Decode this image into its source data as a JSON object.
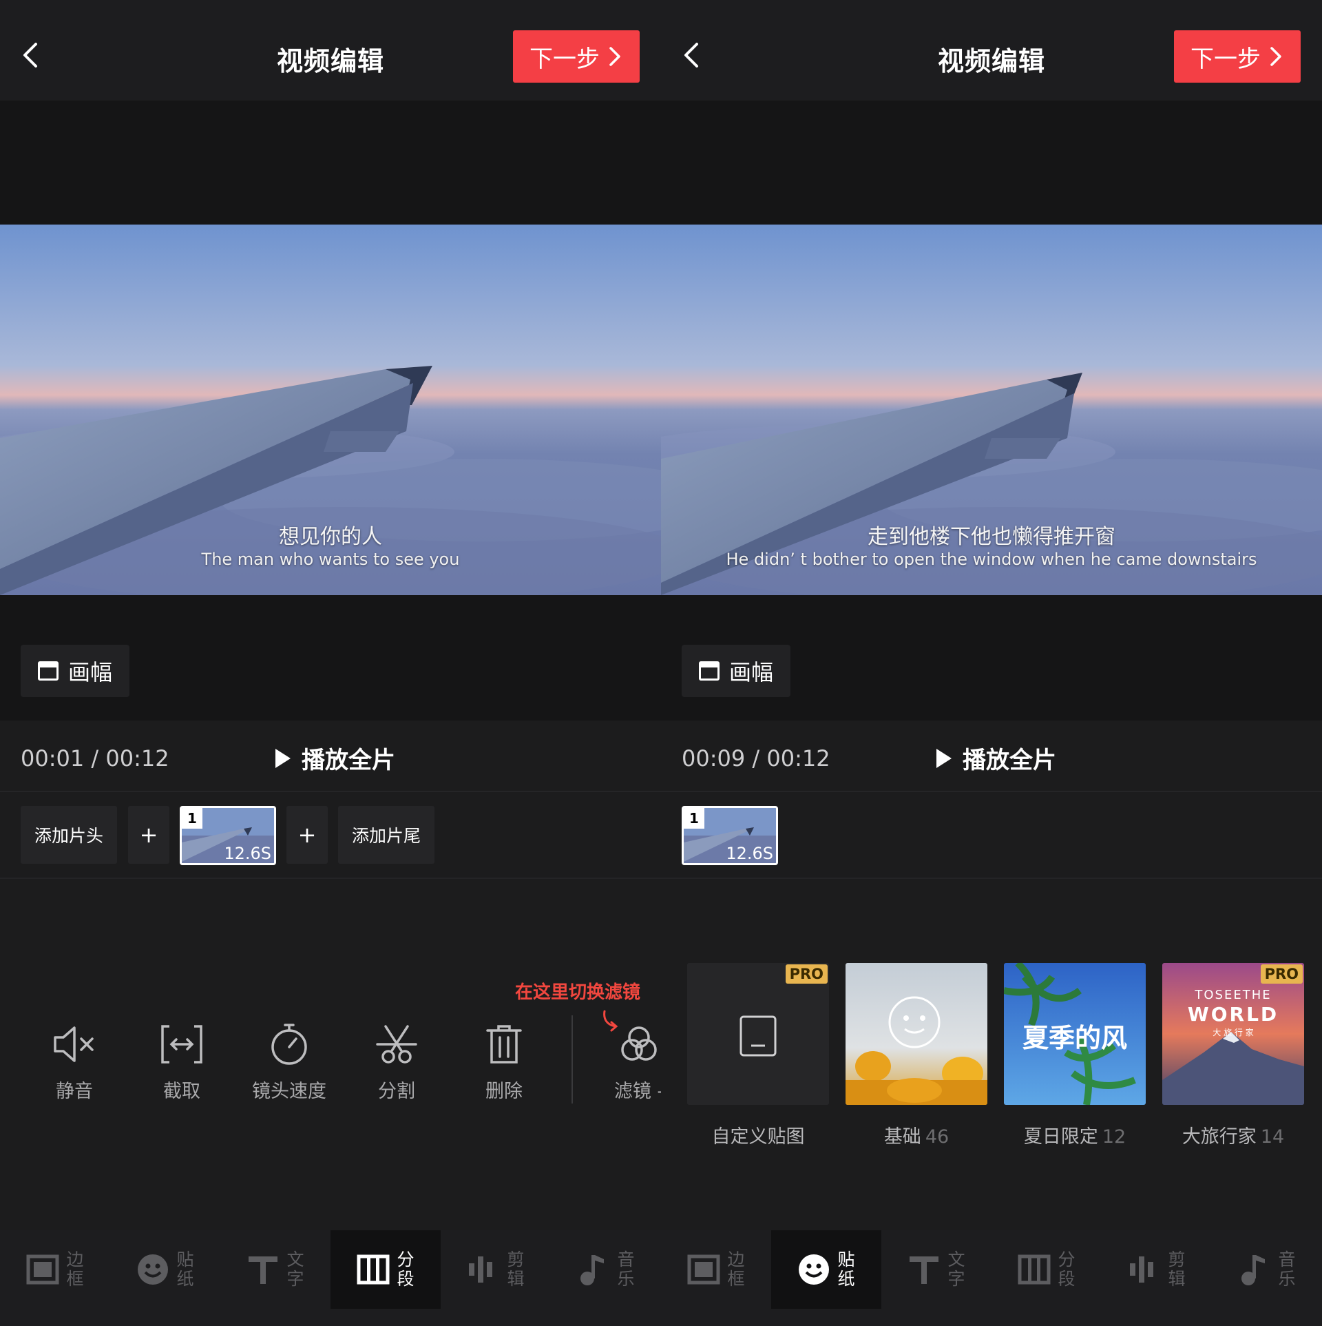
{
  "left": {
    "header": {
      "title": "视频编辑",
      "next_label": "下一步"
    },
    "subtitle": {
      "cn": "想见你的人",
      "en": "The man who wants to see you"
    },
    "frame_label": "画幅",
    "time": "00:01 / 00:12",
    "play_label": "播放全片",
    "strip": {
      "head_label": "添加片头",
      "tail_label": "添加片尾",
      "plus": "+",
      "clip_index": "1",
      "clip_duration": "12.6S"
    },
    "hint": "在这里切换滤镜",
    "tools": [
      {
        "label": "静音",
        "icon": "mute-icon"
      },
      {
        "label": "截取",
        "icon": "trim-icon"
      },
      {
        "label": "镜头速度",
        "icon": "stopwatch-icon"
      },
      {
        "label": "分割",
        "icon": "scissors-icon"
      },
      {
        "label": "删除",
        "icon": "trash-icon"
      },
      {
        "label": "滤镜 -",
        "icon": "filter-icon"
      }
    ],
    "nav": [
      {
        "label": "边框",
        "icon": "frame-icon"
      },
      {
        "label": "贴纸",
        "icon": "smiley-icon"
      },
      {
        "label": "文字",
        "icon": "text-icon"
      },
      {
        "label": "分段",
        "icon": "segment-icon",
        "active": true
      },
      {
        "label": "剪辑",
        "icon": "edit-bars-icon"
      },
      {
        "label": "音乐",
        "icon": "music-note-icon"
      }
    ]
  },
  "right": {
    "header": {
      "title": "视频编辑",
      "next_label": "下一步"
    },
    "subtitle": {
      "cn": "走到他楼下他也懒得推开窗",
      "en": "He didn’ t bother to open the window when he came downstairs"
    },
    "frame_label": "画幅",
    "time": "00:09 / 00:12",
    "play_label": "播放全片",
    "strip": {
      "clip_index": "1",
      "clip_duration": "12.6S"
    },
    "stickers": [
      {
        "label": "自定义贴图",
        "count": "",
        "pro": "PRO"
      },
      {
        "label": "基础",
        "count": "46"
      },
      {
        "label": "夏日限定",
        "count": "12",
        "art_text": "夏季的风"
      },
      {
        "label": "大旅行家",
        "count": "14",
        "pro": "PRO",
        "art_line1": "TOSEETHE",
        "art_line2": "WORLD",
        "art_line3": "大  旅  行  家"
      }
    ],
    "nav": [
      {
        "label": "边框",
        "icon": "frame-icon"
      },
      {
        "label": "贴纸",
        "icon": "smiley-icon",
        "active": true
      },
      {
        "label": "文字",
        "icon": "text-icon"
      },
      {
        "label": "分段",
        "icon": "segment-icon"
      },
      {
        "label": "剪辑",
        "icon": "edit-bars-icon"
      },
      {
        "label": "音乐",
        "icon": "music-note-icon"
      }
    ]
  },
  "colors": {
    "accent_red": "#f43f45",
    "pro_gold": "#e8b550",
    "background": "#161617"
  }
}
